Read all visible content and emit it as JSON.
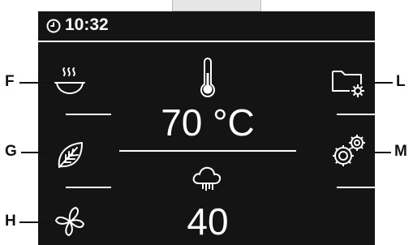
{
  "status": {
    "time": "10:32"
  },
  "main": {
    "temperature": "70 °C",
    "humidity": "40"
  },
  "callouts": {
    "f": "F",
    "g": "G",
    "h": "H",
    "l": "L",
    "m": "M"
  },
  "icons": {
    "clock": "clock-icon",
    "steaming_bowl": "steaming-bowl-icon",
    "leaf": "leaf-icon",
    "fan": "fan-icon",
    "thermometer": "thermometer-icon",
    "humidity_cloud": "humidity-cloud-icon",
    "folder_settings": "folder-settings-icon",
    "gears": "gears-icon"
  },
  "colors": {
    "screen": "#141414",
    "foreground": "#ffffff"
  }
}
